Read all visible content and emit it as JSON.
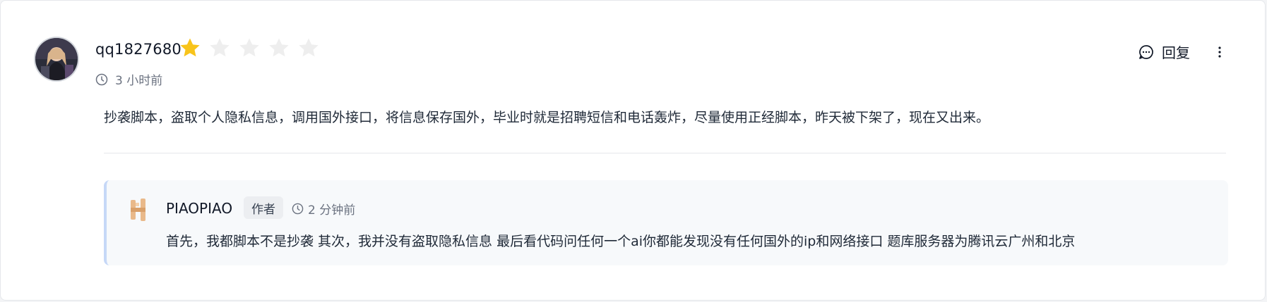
{
  "comment": {
    "username": "qq1827680",
    "rating": 1,
    "rating_max": 5,
    "time": "3 小时前",
    "text": "抄袭脚本，盗取个人隐私信息，调用国外接口，将信息保存国外，毕业时就是招聘短信和电话轰炸，尽量使用正经脚本，昨天被下架了，现在又出来。",
    "reply_label": "回复",
    "icons": {
      "avatar": "user-avatar",
      "clock": "clock-icon",
      "reply": "chat-bubble-icon",
      "more": "more-vertical-icon"
    }
  },
  "reply": {
    "author": "PIAOPIAO",
    "badge": "作者",
    "time": "2 分钟前",
    "text": "首先，我都脚本不是抄袭 其次，我并没有盗取隐私信息 最后看代码问任何一个ai你都能发现没有任何国外的ip和网络接口 题库服务器为腾讯云广州和北京"
  },
  "colors": {
    "star_filled": "#f8c41b",
    "star_empty": "#eeeeee",
    "reply_border": "#c6d8f7",
    "reply_bg": "#f7f9fb"
  }
}
